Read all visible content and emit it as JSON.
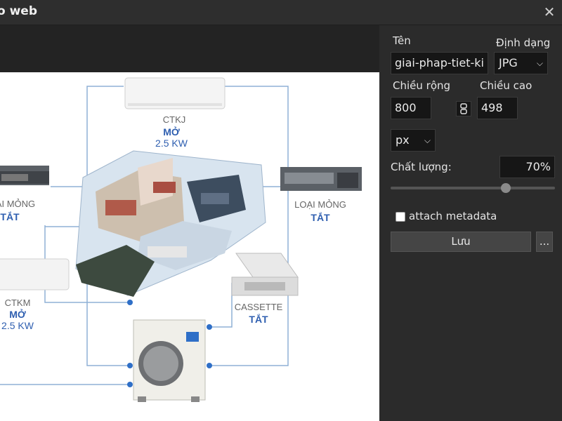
{
  "window": {
    "title": "o web",
    "close_glyph": "✕"
  },
  "preview": {
    "labels": {
      "ctkj_model": "CTKJ",
      "ctkj_state": "MỞ",
      "ctkj_power": "2.5 KW",
      "left_ducted_model": "ẠI MỎNG",
      "left_ducted_state": "TẮT",
      "right_ducted_model": "LOẠI MỎNG",
      "right_ducted_state": "TẮT",
      "ctkm_model": "CTKM",
      "ctkm_state": "MỞ",
      "ctkm_power": "2.5 KW",
      "cassette_model": "CASSETTE",
      "cassette_state": "TẮT"
    }
  },
  "export": {
    "name_label": "Tên",
    "name_value": "giai-phap-tiet-ki",
    "format_label": "Định dạng",
    "format_value": "JPG",
    "width_label": "Chiều rộng",
    "width_value": "800",
    "height_label": "Chiều cao",
    "height_value": "498",
    "unit_value": "px",
    "quality_label": "Chất lượng:",
    "quality_value": "70%",
    "quality_fraction": 0.7,
    "metadata_label": "attach metadata",
    "metadata_checked": false,
    "save_label": "Lưu",
    "more_label": "..."
  },
  "colors": {
    "accent_blue": "#2f5fb0",
    "line_blue": "#7fa3cc",
    "panel_bg": "#2b2b2b",
    "field_bg": "#161616"
  }
}
